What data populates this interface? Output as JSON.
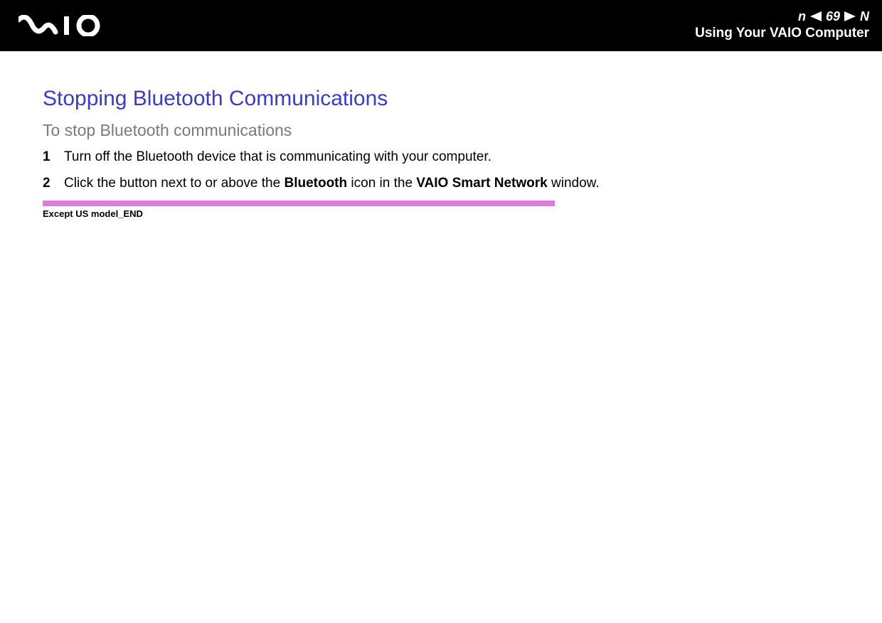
{
  "header": {
    "page_number": "69",
    "n_prefix": "n",
    "n_suffix": "N",
    "section": "Using Your VAIO Computer"
  },
  "content": {
    "title": "Stopping Bluetooth Communications",
    "subtitle": "To stop Bluetooth communications",
    "steps": [
      {
        "num": "1",
        "text_prefix": "Turn off the Bluetooth device that is communicating with your computer.",
        "bold1": "",
        "text_mid": "",
        "bold2": "",
        "text_suffix": ""
      },
      {
        "num": "2",
        "text_prefix": "Click the button next to or above the ",
        "bold1": "Bluetooth",
        "text_mid": " icon in the ",
        "bold2": "VAIO Smart Network",
        "text_suffix": " window."
      }
    ],
    "marker": "Except US model_END"
  }
}
